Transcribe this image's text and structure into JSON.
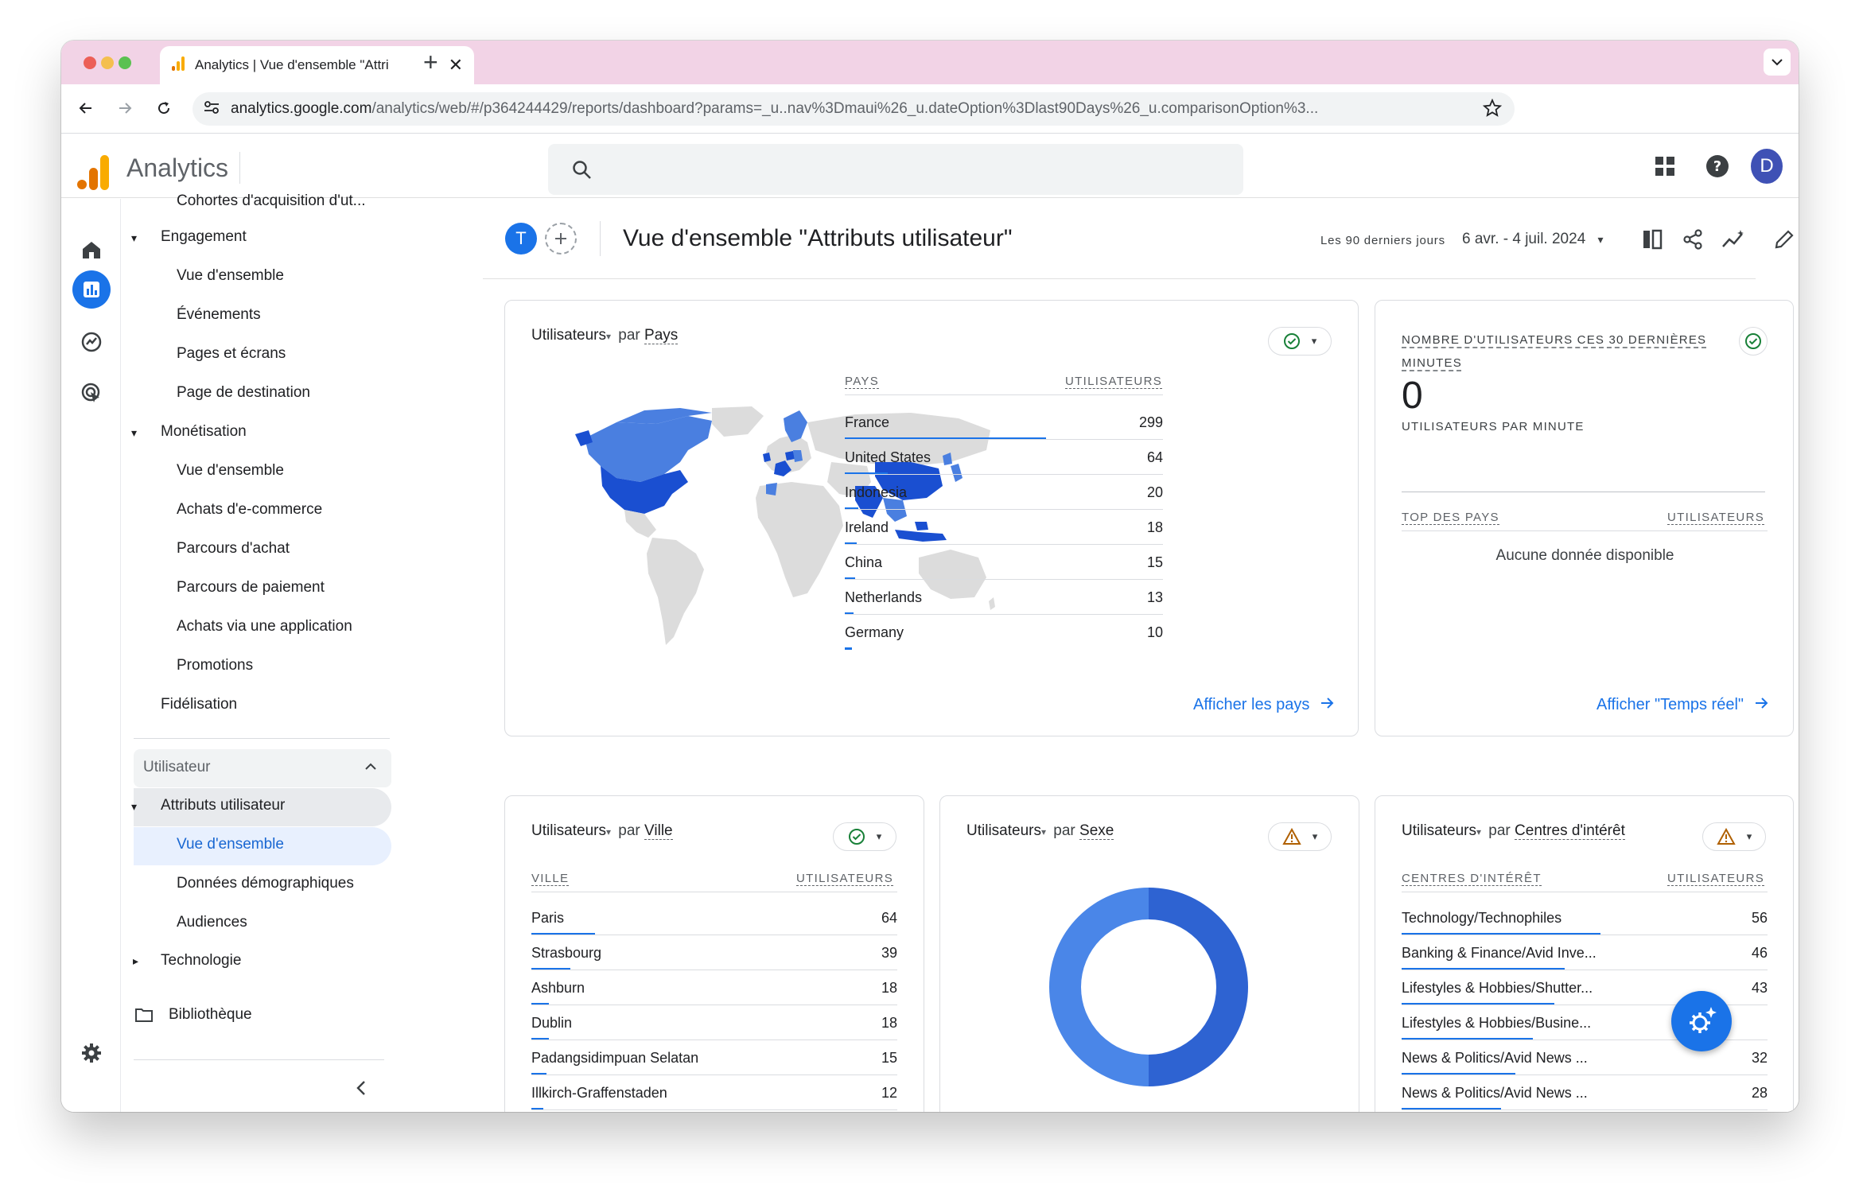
{
  "browser": {
    "tab_title": "Analytics | Vue d'ensemble \"Attri",
    "url_host": "analytics.google.com",
    "url_path": "/analytics/web/#/p364244429/reports/dashboard?params=_u..nav%3Dmaui%26_u.dateOption%3Dlast90Days%26_u.comparisonOption%3..."
  },
  "app": {
    "name": "Analytics",
    "avatar_letter": "D"
  },
  "nav": {
    "cut_item": "Cohortes d'acquisition d'ut...",
    "engagement": "Engagement",
    "engagement_items": [
      "Vue d'ensemble",
      "Événements",
      "Pages et écrans",
      "Page de destination"
    ],
    "monetisation": "Monétisation",
    "monetisation_items": [
      "Vue d'ensemble",
      "Achats d'e-commerce",
      "Parcours d'achat",
      "Parcours de paiement",
      "Achats via une application",
      "Promotions"
    ],
    "fidelisation": "Fidélisation",
    "section": "Utilisateur",
    "attributs": "Attributs utilisateur",
    "attributs_items": [
      "Vue d'ensemble",
      "Données démographiques",
      "Audiences"
    ],
    "technologie": "Technologie",
    "bibliotheque": "Bibliothèque"
  },
  "header": {
    "avatar_letter": "T",
    "title": "Vue d'ensemble \"Attributs utilisateur\"",
    "date_label": "Les 90 derniers jours",
    "date_range": "6 avr. - 4 juil. 2024"
  },
  "card_pays": {
    "metric": "Utilisateurs",
    "by": "par",
    "dimension": "Pays",
    "col1": "PAYS",
    "col2": "UTILISATEURS",
    "rows": [
      {
        "name": "France",
        "value": "299"
      },
      {
        "name": "United States",
        "value": "64"
      },
      {
        "name": "Indonesia",
        "value": "20"
      },
      {
        "name": "Ireland",
        "value": "18"
      },
      {
        "name": "China",
        "value": "15"
      },
      {
        "name": "Netherlands",
        "value": "13"
      },
      {
        "name": "Germany",
        "value": "10"
      }
    ],
    "link": "Afficher les pays"
  },
  "card_realtime": {
    "title": "NOMBRE D'UTILISATEURS CES 30 DERNIÈRES MINUTES",
    "value": "0",
    "subtitle": "UTILISATEURS PAR MINUTE",
    "col1": "TOP DES PAYS",
    "col2": "UTILISATEURS",
    "empty": "Aucune donnée disponible",
    "link": "Afficher \"Temps réel\""
  },
  "card_ville": {
    "metric": "Utilisateurs",
    "by": "par",
    "dimension": "Ville",
    "col1": "VILLE",
    "col2": "UTILISATEURS",
    "rows": [
      {
        "name": "Paris",
        "value": "64"
      },
      {
        "name": "Strasbourg",
        "value": "39"
      },
      {
        "name": "Ashburn",
        "value": "18"
      },
      {
        "name": "Dublin",
        "value": "18"
      },
      {
        "name": "Padangsidimpuan Selatan",
        "value": "15"
      },
      {
        "name": "Illkirch-Graffenstaden",
        "value": "12"
      }
    ]
  },
  "card_sexe": {
    "metric": "Utilisateurs",
    "by": "par",
    "dimension": "Sexe",
    "donut_share": 0.5
  },
  "card_interets": {
    "metric": "Utilisateurs",
    "by": "par",
    "dimension": "Centres d'intérêt",
    "col1": "CENTRES D'INTÉRÊT",
    "col2": "UTILISATEURS",
    "rows": [
      {
        "name": "Technology/Technophiles",
        "value": "56"
      },
      {
        "name": "Banking & Finance/Avid Inve...",
        "value": "46"
      },
      {
        "name": "Lifestyles & Hobbies/Shutter...",
        "value": "43"
      },
      {
        "name": "Lifestyles & Hobbies/Busine...",
        "value": ""
      },
      {
        "name": "News & Politics/Avid News ...",
        "value": "32"
      },
      {
        "name": "News & Politics/Avid News ...",
        "value": "28"
      }
    ]
  },
  "colors": {
    "accent": "#1a73e8",
    "dark_blue": "#1a4fd1",
    "map_blue": "#4a7fe0",
    "map_grey": "#dcdcdc"
  }
}
